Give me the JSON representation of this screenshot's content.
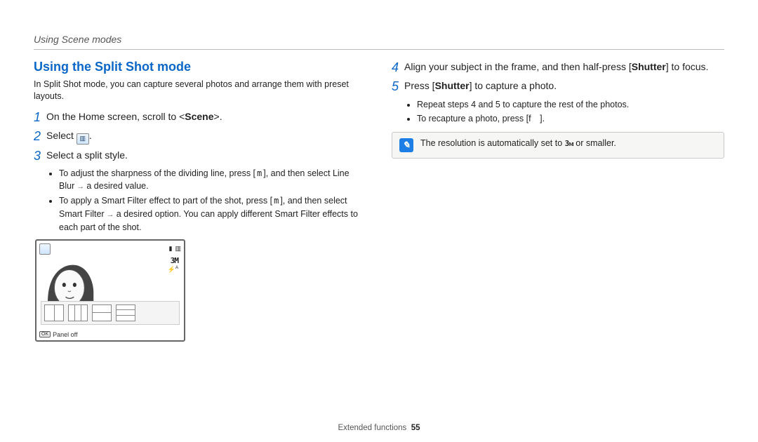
{
  "running_header": "Using Scene modes",
  "section_title": "Using the Split Shot mode",
  "intro": "In Split Shot mode, you can capture several photos and arrange them with preset layouts.",
  "left_steps": [
    {
      "n": "1",
      "parts": [
        "On the Home screen, scroll to <",
        "Scene",
        ">."
      ]
    },
    {
      "n": "2",
      "parts": [
        "Select ",
        "ICON",
        "."
      ]
    },
    {
      "n": "3",
      "parts": [
        "Select a split style."
      ]
    }
  ],
  "left_bullets": [
    {
      "lead": "To adjust the sharpness of the dividing line, press [",
      "btn": "m",
      "mid": "], and then select ",
      "bold": "Line Blur",
      "tail": " a desired value."
    },
    {
      "lead": "To apply a Smart Filter effect to part of the shot, press [",
      "btn": "m",
      "mid": "], and then select ",
      "bold": "Smart Filter",
      "tail": " a desired option. You can apply different Smart Filter effects to each part of the shot."
    }
  ],
  "camera": {
    "res": "3M",
    "flash": "ꜰᴬ",
    "panel_label": "Panel off",
    "ok": "OK"
  },
  "right_steps": [
    {
      "n": "4",
      "parts": [
        "Align your subject in the frame, and then half-press [",
        "Shutter",
        "] to focus."
      ]
    },
    {
      "n": "5",
      "parts": [
        "Press [",
        "Shutter",
        "] to capture a photo."
      ]
    }
  ],
  "right_bullets": [
    "Repeat steps 4 and 5 to capture the rest of the photos.",
    "To recapture a photo, press [f ]."
  ],
  "note": {
    "pre": "The resolution is automatically set to ",
    "glyph": "3ᴍ",
    "post": " or smaller."
  },
  "footer": {
    "section": "Extended functions",
    "page": "55"
  }
}
